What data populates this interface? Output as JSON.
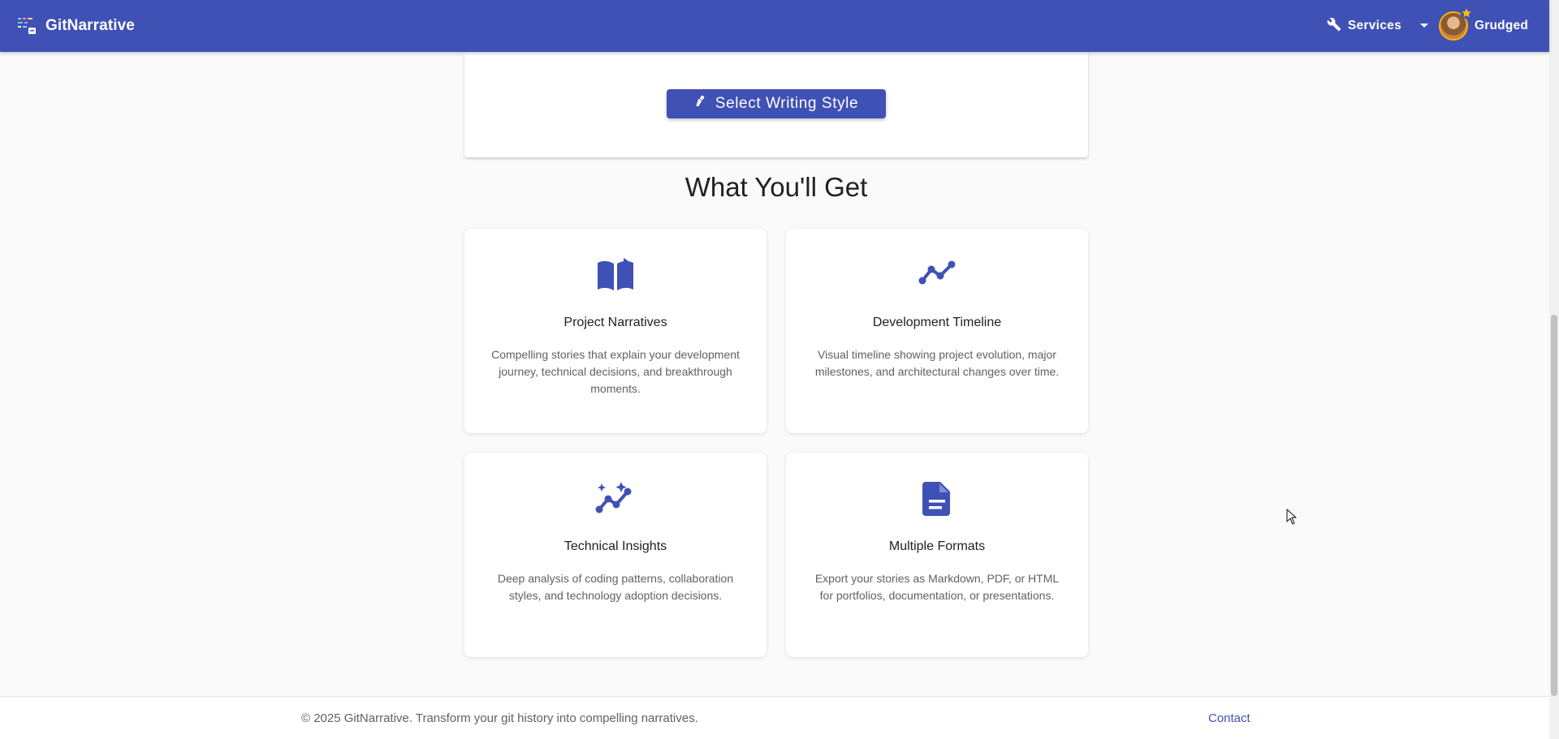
{
  "header": {
    "brand_name": "GitNarrative",
    "services_label": "Services",
    "user_name": "Grudged"
  },
  "top_card": {
    "select_style_label": "Select Writing Style"
  },
  "section": {
    "title": "What You'll Get"
  },
  "features": [
    {
      "icon": "book-open-icon",
      "title": "Project Narratives",
      "description": "Compelling stories that explain your development journey, technical decisions, and breakthrough moments."
    },
    {
      "icon": "timeline-icon",
      "title": "Development Timeline",
      "description": "Visual timeline showing project evolution, major milestones, and architectural changes over time."
    },
    {
      "icon": "auto-graph-icon",
      "title": "Technical Insights",
      "description": "Deep analysis of coding patterns, collaboration styles, and technology adoption decisions."
    },
    {
      "icon": "document-icon",
      "title": "Multiple Formats",
      "description": "Export your stories as Markdown, PDF, or HTML for portfolios, documentation, or presentations."
    }
  ],
  "footer": {
    "copyright": "© 2025 GitNarrative. Transform your git history into compelling narratives.",
    "contact_label": "Contact"
  },
  "colors": {
    "primary": "#3f51b5",
    "background": "#fafafa",
    "avatar_ring": "#ffb300"
  }
}
